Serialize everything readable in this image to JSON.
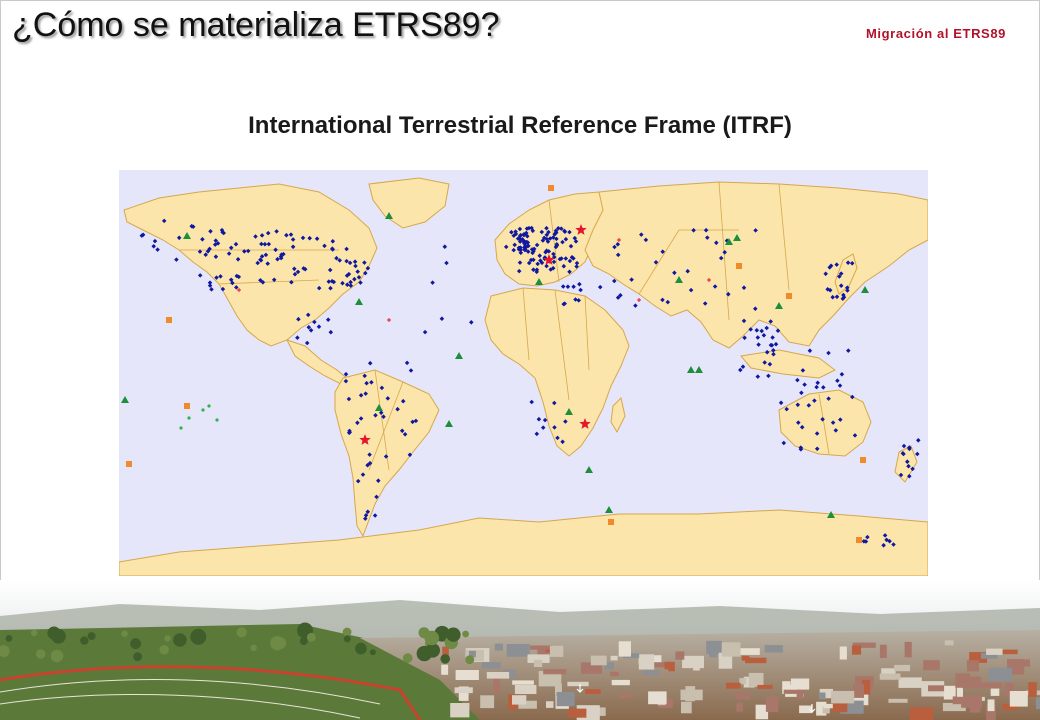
{
  "slide": {
    "title": "¿Cómo se materializa ETRS89?",
    "corner_label": "Migración al ETRS89",
    "subtitle": "International Terrestrial Reference Frame (ITRF)"
  },
  "map": {
    "ocean_color": "#e6e6fb",
    "land_color": "#fbe5ab",
    "border_color": "#d7a74a",
    "markers": {
      "station_color": "#1018a0",
      "triangle_color": "#1d8f3a",
      "square_color": "#f08a2a",
      "star_color": "#e5162b",
      "cross_color": "#e5162b",
      "dot_color": "#2fb24a"
    }
  },
  "photo": {
    "sky_color": "#eef0f2",
    "icons": [
      "pin-icon",
      "pin-icon"
    ]
  }
}
